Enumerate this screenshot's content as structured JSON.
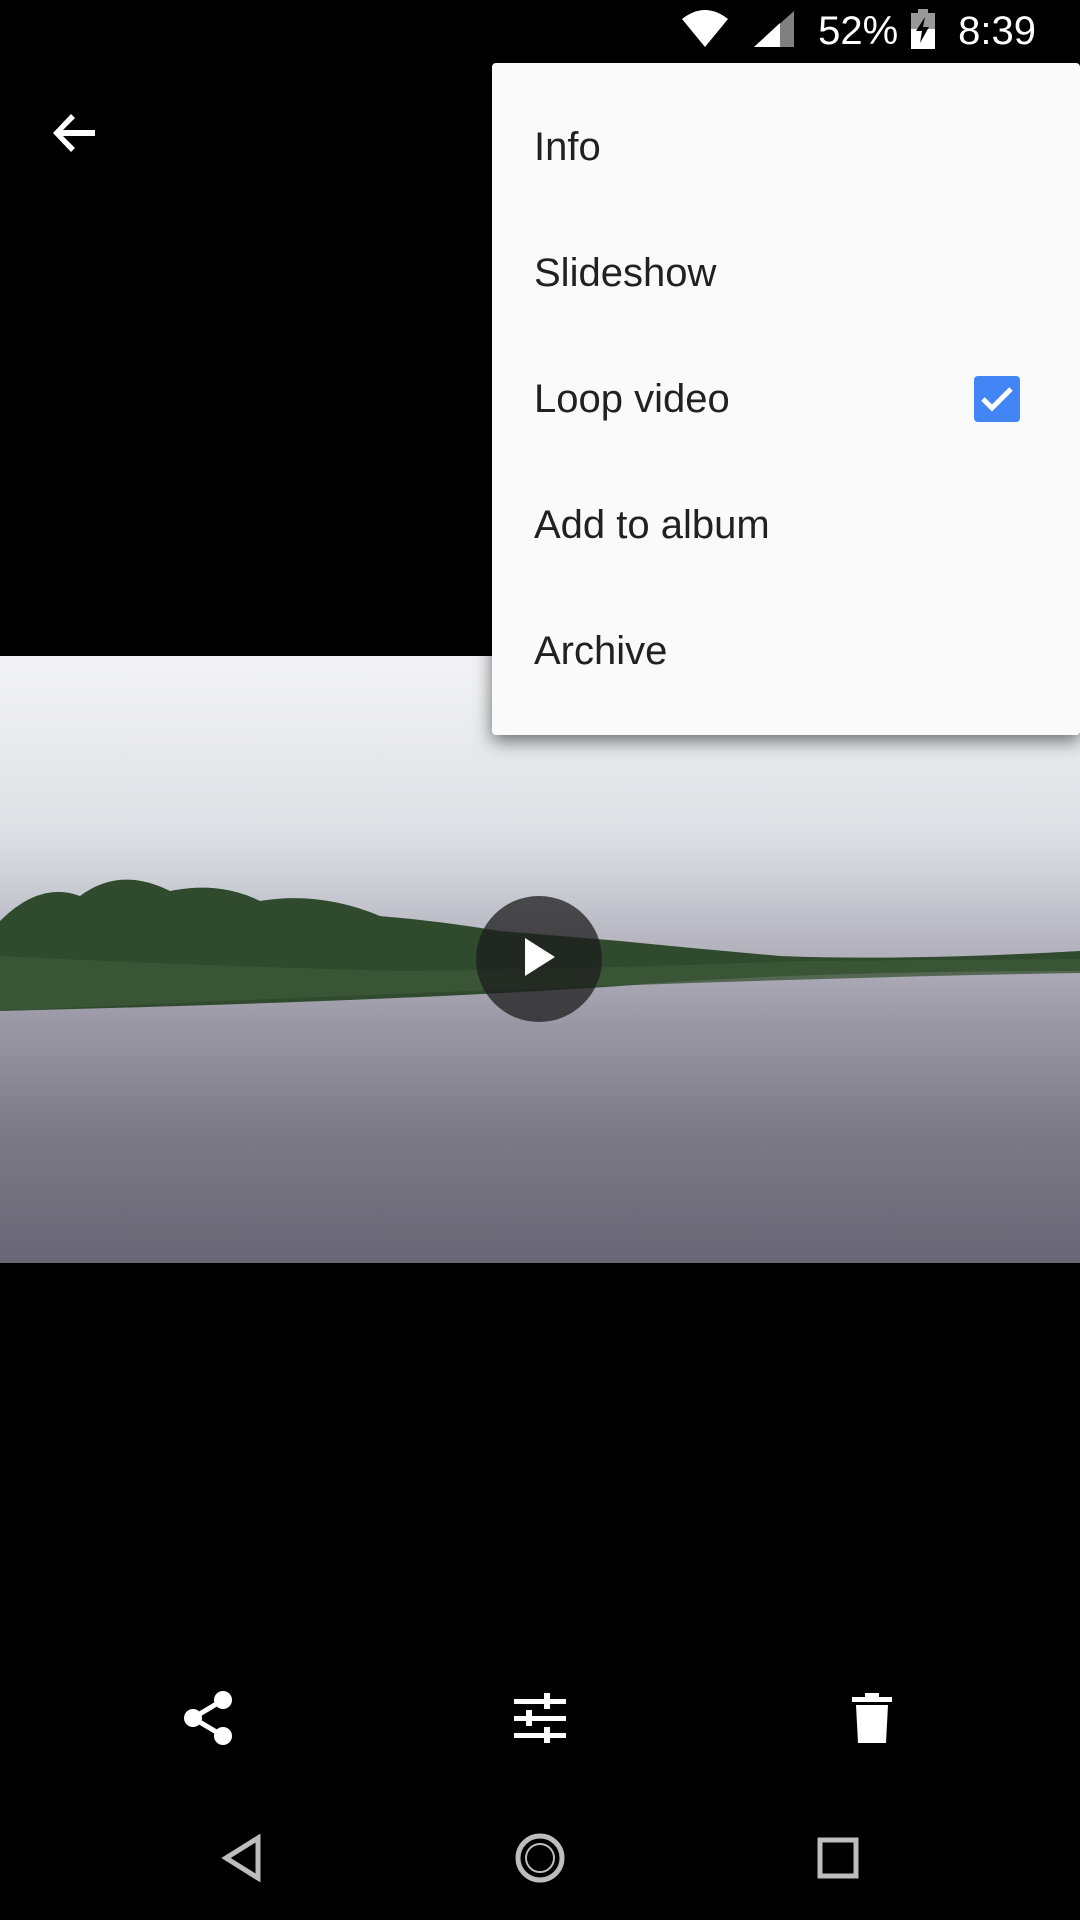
{
  "status_bar": {
    "battery_percent": "52%",
    "time": "8:39",
    "icons": [
      "wifi-icon",
      "cell-signal-icon",
      "battery-icon"
    ]
  },
  "toolbar": {
    "back_icon": "arrow-back-icon"
  },
  "menu": {
    "items": [
      {
        "label": "Info"
      },
      {
        "label": "Slideshow"
      },
      {
        "label": "Loop video",
        "checked": true
      },
      {
        "label": "Add to album"
      },
      {
        "label": "Archive"
      }
    ]
  },
  "media": {
    "play_icon": "play-icon"
  },
  "actions": {
    "icons": [
      "share-icon",
      "edit-sliders-icon",
      "delete-icon"
    ]
  },
  "nav": {
    "icons": [
      "nav-back-icon",
      "nav-home-icon",
      "nav-recents-icon"
    ]
  },
  "colors": {
    "accent": "#4285f4",
    "menu_bg": "#fafafa",
    "text": "#212121"
  }
}
